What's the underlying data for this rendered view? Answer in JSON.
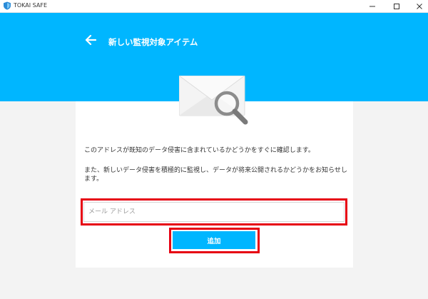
{
  "window": {
    "title": "TOKAI SAFE"
  },
  "header": {
    "title": "新しい監視対象アイテム"
  },
  "content": {
    "description_1": "このアドレスが既知のデータ侵害に含まれているかどうかをすぐに確認します。",
    "description_2": "また、新しいデータ侵害を積極的に監視し、データが将来公開されるかどうかをお知らせします。"
  },
  "form": {
    "email_value": "",
    "email_placeholder": "メール アドレス",
    "add_label": "追加"
  },
  "colors": {
    "accent": "#00b6ff",
    "highlight": "#e60012",
    "background": "#f3f3f3",
    "card": "#ffffff"
  },
  "icons": [
    "shield-logo-icon",
    "minimize-icon",
    "maximize-icon",
    "close-icon",
    "back-arrow-icon",
    "envelope-search-icon"
  ]
}
